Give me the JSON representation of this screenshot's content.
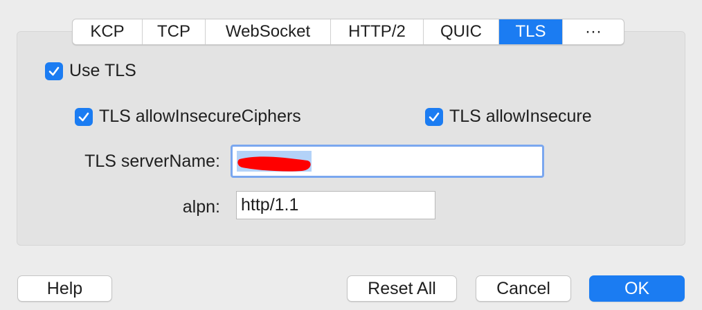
{
  "tabs": [
    "KCP",
    "TCP",
    "WebSocket",
    "HTTP/2",
    "QUIC",
    "TLS",
    "···"
  ],
  "active_tab": "TLS",
  "use_tls": {
    "label": "Use TLS",
    "checked": true
  },
  "allow_insecure_ciphers": {
    "label": "TLS allowInsecureCiphers",
    "checked": true
  },
  "allow_insecure": {
    "label": "TLS allowInsecure",
    "checked": true
  },
  "server_name": {
    "label": "TLS serverName:",
    "value": ""
  },
  "alpn": {
    "label": "alpn:",
    "value": "http/1.1"
  },
  "buttons": {
    "help": "Help",
    "reset": "Reset All",
    "cancel": "Cancel",
    "ok": "OK"
  },
  "colors": {
    "accent": "#1b7cf2",
    "redaction": "#ff0000",
    "selection": "#b3d2f8"
  }
}
